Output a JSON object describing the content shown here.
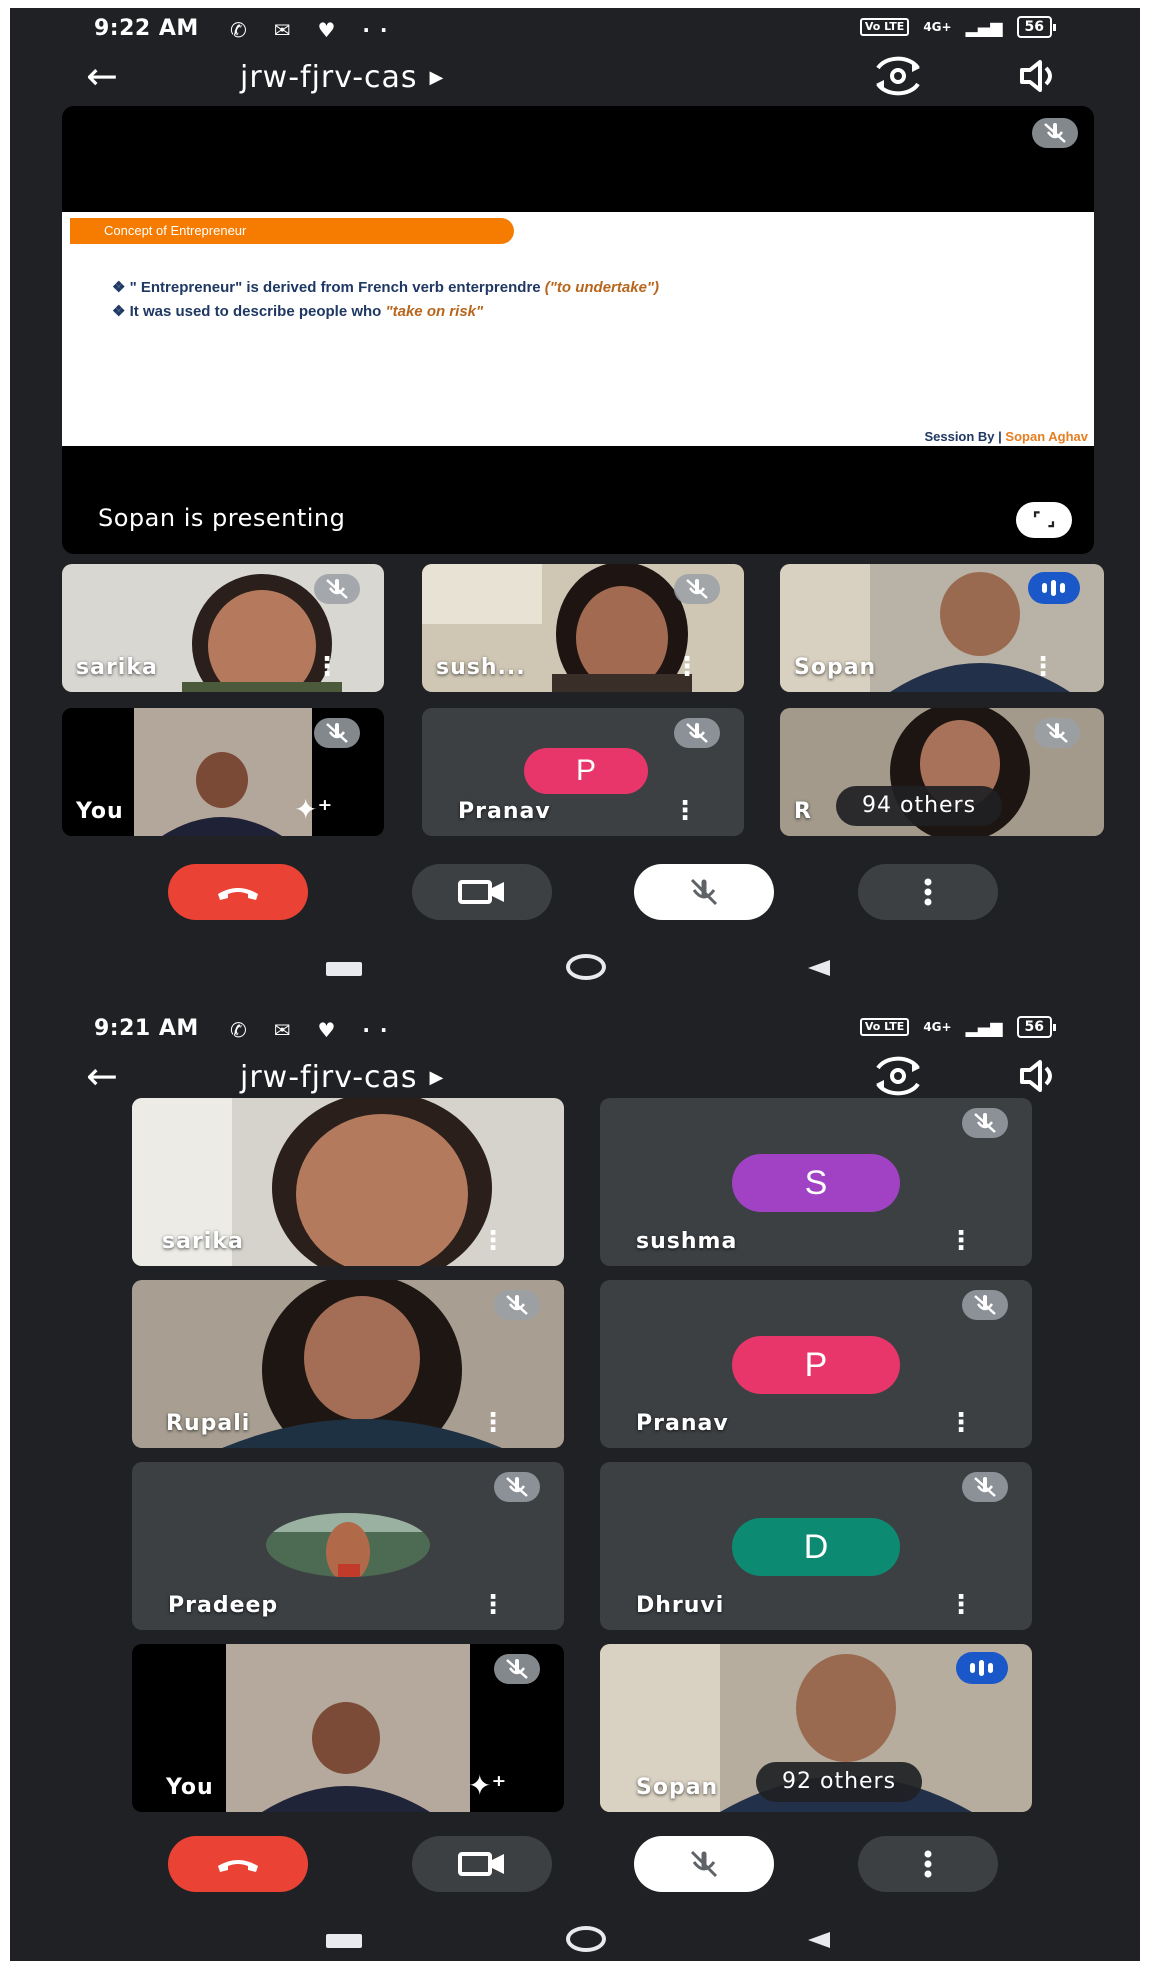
{
  "top": {
    "status": {
      "time": "9:22 AM",
      "network": "4G+",
      "battery": "56"
    },
    "meeting_code": "jrw-fjrv-cas",
    "slide": {
      "banner": "Concept of Entrepreneur",
      "bullet1_prefix": "❖ \" Entrepreneur\" is derived from French verb enterprendre ",
      "bullet1_em": "(\"to undertake\")",
      "bullet2_prefix": "❖ It was used to describe people who ",
      "bullet2_em": "\"take on risk\"",
      "footer_label": "Session By |",
      "footer_name": " Sopan Aghav"
    },
    "presenting_text": "Sopan is presenting",
    "tiles": [
      {
        "name": "sarika"
      },
      {
        "name": "sush..."
      },
      {
        "name": "Sopan"
      },
      {
        "name": "You"
      },
      {
        "name": "Pranav",
        "initial": "P"
      },
      {
        "name": "R"
      }
    ],
    "others_label": "94 others"
  },
  "bottom": {
    "status": {
      "time": "9:21 AM",
      "network": "4G+",
      "battery": "56"
    },
    "meeting_code": "jrw-fjrv-cas",
    "tiles": [
      {
        "name": "sarika"
      },
      {
        "name": "sushma",
        "initial": "S"
      },
      {
        "name": "Rupali"
      },
      {
        "name": "Pranav",
        "initial": "P"
      },
      {
        "name": "Pradeep"
      },
      {
        "name": "Dhruvi",
        "initial": "D"
      },
      {
        "name": "You"
      },
      {
        "name": "Sopan"
      }
    ],
    "others_label": "92 others"
  },
  "colors": {
    "background": "#202124",
    "tile": "#3c4043",
    "hangup": "#ea4335",
    "speaking": "#1a57c9",
    "avatar_pink": "#e8366b",
    "avatar_purple": "#a142c4",
    "avatar_teal": "#0d8a72"
  },
  "icons": [
    "back-arrow-icon",
    "switch-camera-icon",
    "volume-icon",
    "mic-off-icon",
    "audio-level-icon",
    "kebab-icon",
    "sparkle-effects-icon",
    "fullscreen-icon",
    "hangup-icon",
    "camera-icon",
    "more-icon"
  ]
}
